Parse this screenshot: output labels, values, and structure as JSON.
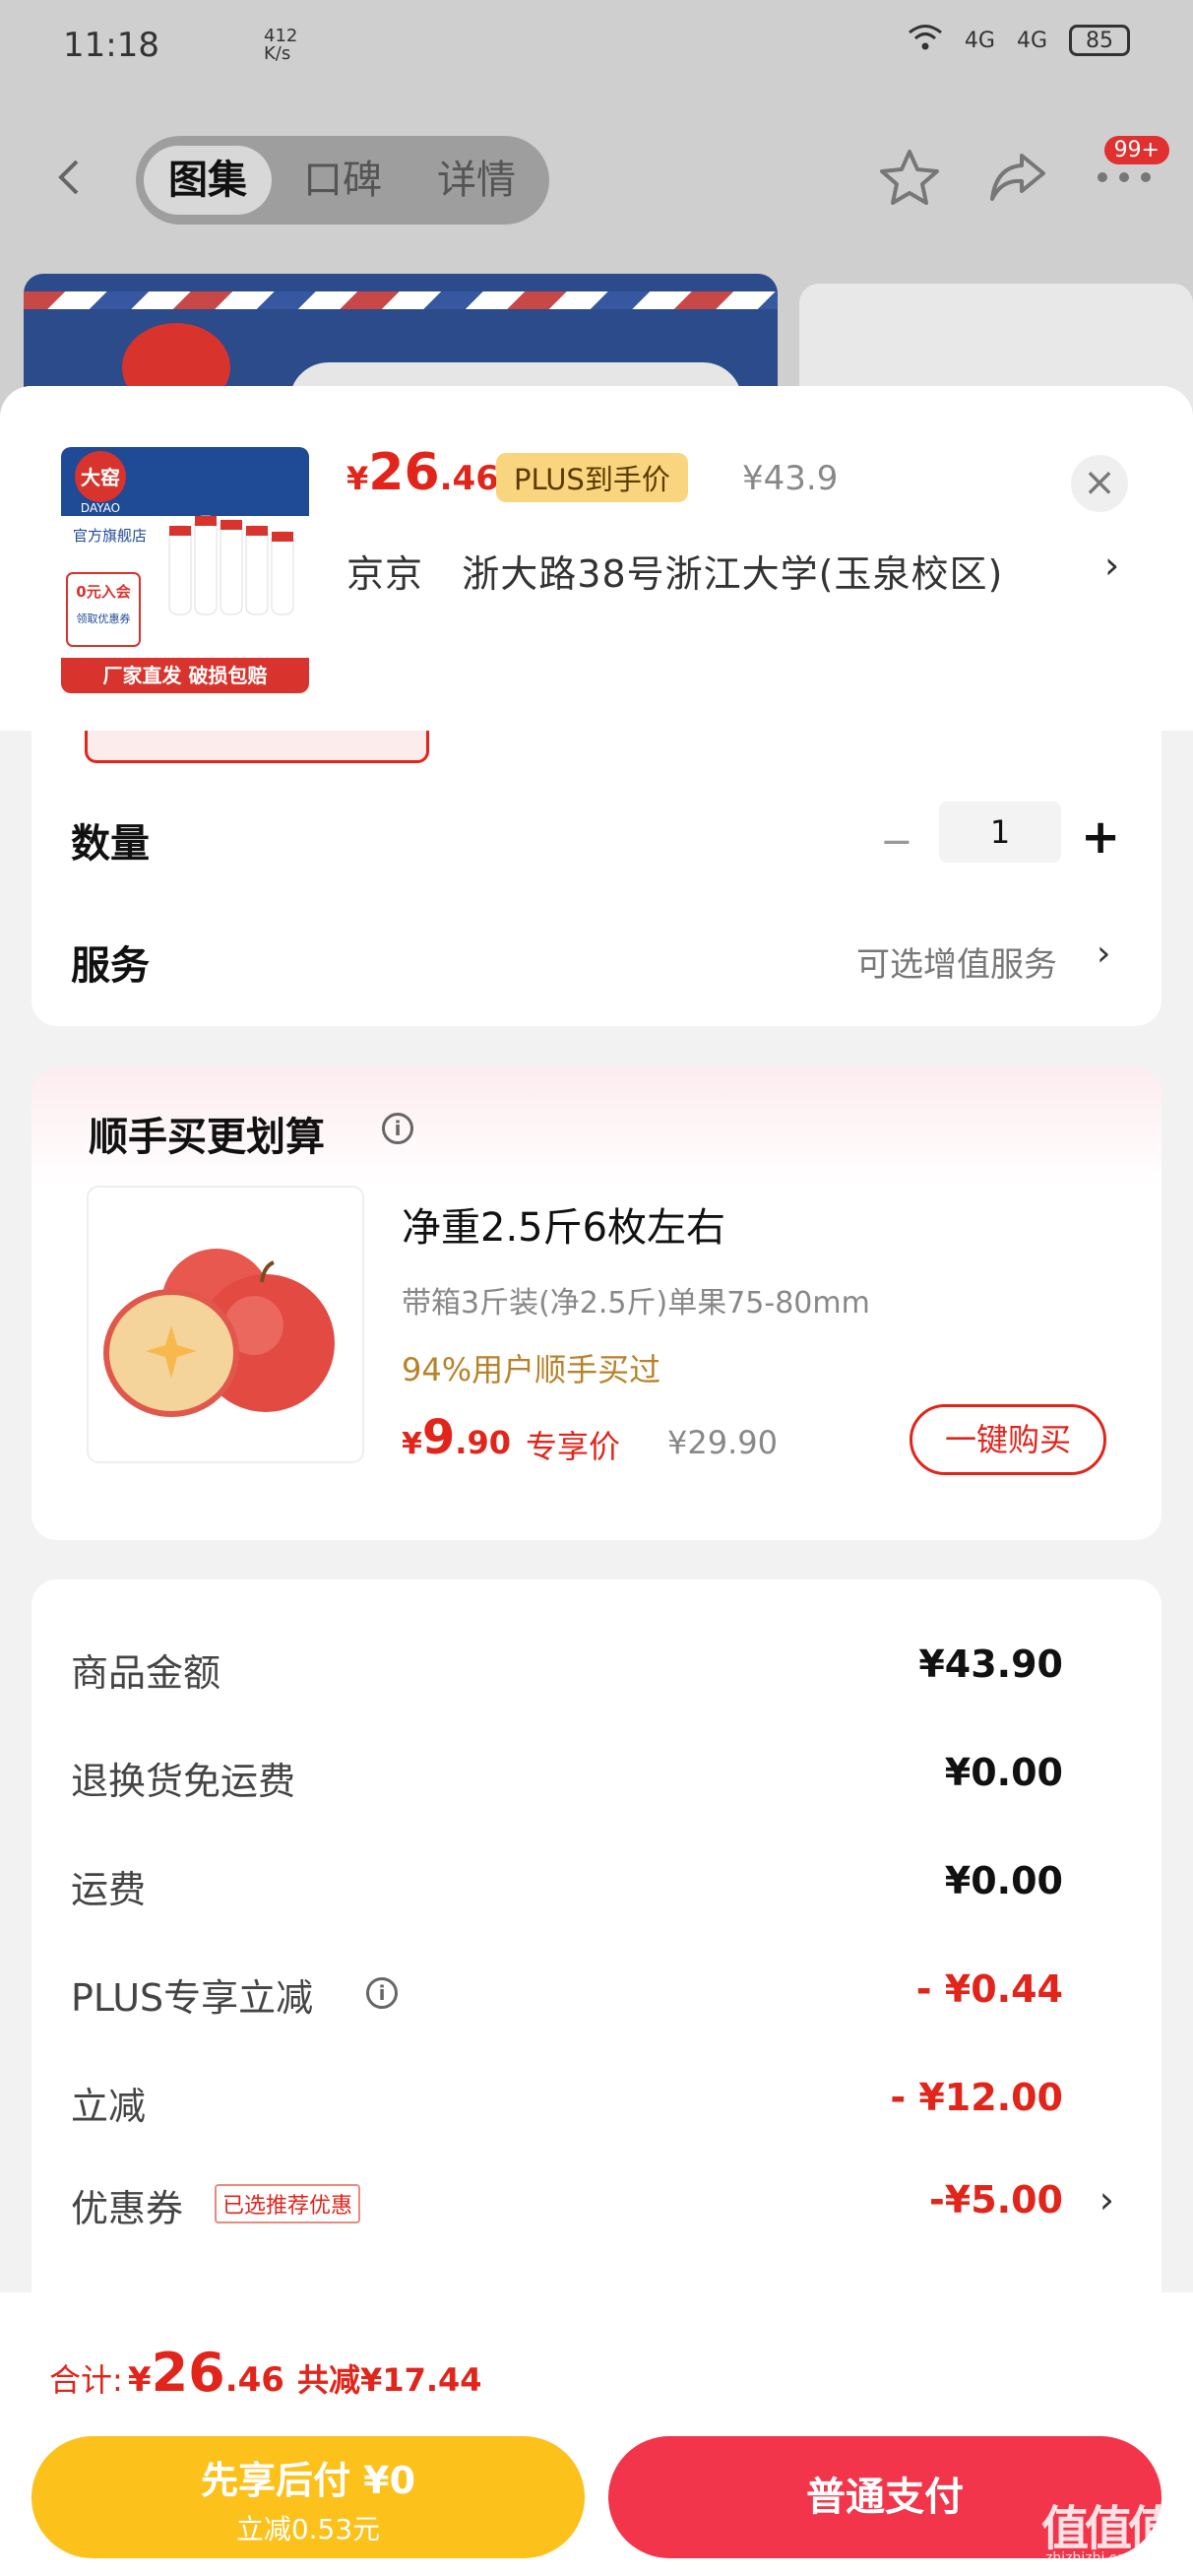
{
  "status_bar": {
    "time": "11:18",
    "speed": "412\nK/s",
    "network": "4G",
    "network2": "4G",
    "battery": "85"
  },
  "nav": {
    "tabs": [
      "图集",
      "口碑",
      "详情"
    ],
    "badge": "99+"
  },
  "product": {
    "price_symbol": "¥",
    "price_int": "26",
    "price_dec": ".46",
    "plus_tag": "PLUS到手价",
    "orig_price": "¥43.9",
    "address_city": "京京",
    "address": "浙大路38号浙江大学(玉泉校区)",
    "thumb": {
      "brand": "大窑",
      "brand_en": "DAYAO",
      "store": "官方旗舰店",
      "promo1": "0元入会",
      "promo2": "领取优惠券",
      "banner": "厂家直发  破损包赔"
    }
  },
  "quantity": {
    "label": "数量",
    "minus": "−",
    "value": "1",
    "plus": "+"
  },
  "service": {
    "label": "服务",
    "value": "可选增值服务"
  },
  "addon": {
    "title": "顺手买更划算",
    "name": "净重2.5斤6枚左右",
    "spec": "带箱3斤装(净2.5斤)单果75-80mm",
    "stat": "94%用户顺手买过",
    "price_symbol": "¥",
    "price_int": "9",
    "price_dec": ".90",
    "exclusive": "专享价",
    "orig_price": "¥29.90",
    "buy_label": "一键购买"
  },
  "summary": {
    "rows": [
      {
        "label": "商品金额",
        "value": "¥43.90"
      },
      {
        "label": "退换货免运费",
        "value": "¥0.00"
      },
      {
        "label": "运费",
        "value": "¥0.00"
      },
      {
        "label": "PLUS专享立减",
        "value": "- ¥0.44"
      },
      {
        "label": "立减",
        "value": "- ¥12.00"
      },
      {
        "label": "优惠券",
        "tag": "已选推荐优惠",
        "value": "-¥5.00"
      }
    ]
  },
  "footer": {
    "total_label": "合计:",
    "total_symbol": "¥",
    "total_int": "26",
    "total_dec": ".46",
    "saved": "共减¥17.44",
    "btn_later_line1": "先享后付 ¥0",
    "btn_later_line2": "立减0.53元",
    "btn_pay": "普通支付"
  },
  "watermark": {
    "logo": "值值值",
    "site": "zhizhizhi.com"
  },
  "colors": {
    "accent": "#e1251b",
    "plus_gold": "#f8d57e",
    "pay_later": "#fcc11b",
    "pay": "#f2354a"
  }
}
